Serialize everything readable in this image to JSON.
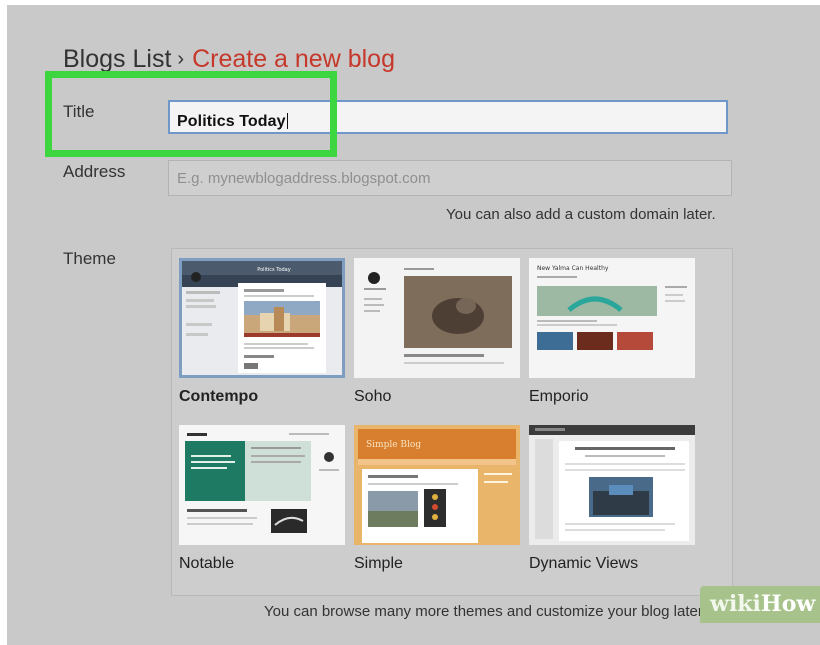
{
  "breadcrumb": {
    "parent": "Blogs List",
    "separator": "›",
    "current": "Create a new blog"
  },
  "form": {
    "title_label": "Title",
    "title_value": "Politics Today",
    "address_label": "Address",
    "address_placeholder": "E.g. mynewblogaddress.blogspot.com",
    "domain_note": "You can also add a custom domain later.",
    "theme_label": "Theme"
  },
  "themes": {
    "selected": "Contempo",
    "items": [
      {
        "name": "Contempo"
      },
      {
        "name": "Soho"
      },
      {
        "name": "Emporio"
      },
      {
        "name": "Notable"
      },
      {
        "name": "Simple"
      },
      {
        "name": "Dynamic Views"
      }
    ],
    "preview_text": {
      "contempo_header": "Politics Today",
      "emporio_header": "New Yalma Can Healthy",
      "simple_header": "Simple Blog"
    },
    "browse_note": "You can browse many more themes and customize your blog later."
  },
  "watermark": {
    "part1": "wiki",
    "part2": "How"
  },
  "colors": {
    "panel_bg": "#c9c9c9",
    "breadcrumb_current": "#c5382a",
    "highlight_border": "#3ed640",
    "input_focus_border": "#6d98c8",
    "selected_theme_border": "#7e9dc1"
  }
}
